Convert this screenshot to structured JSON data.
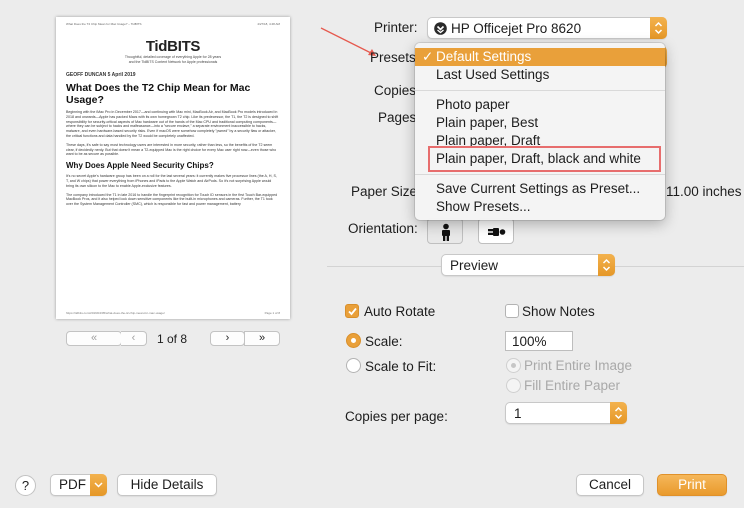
{
  "preview": {
    "header_left": "What Does the T2 Chip Mean for Mac Usage? – TidBITS",
    "header_right": "4/27/18, 4:48 AM",
    "logo": "TidBITS",
    "tagline_1": "Thoughtful, detailed coverage of everything Apple for 28 years",
    "tagline_2": "and the TidBITS Content Network for Apple professionals",
    "meta": "GEOFF DUNCAN  5 April 2019",
    "title": "What Does the T2 Chip Mean for Mac Usage?",
    "para1": "Beginning with the iMac Pro in December 2017—and continuing with Mac mini, MacBook Air, and MacBook Pro models introduced in 2018 and onwards—Apple has packed Macs with its own homegrown T2 chip. Like its predecessor, the T1, the T2 is designed to shift responsibility for security-critical aspects of Mac hardware out of the hands of the Mac CPU and traditional computing components—where they can be subject to hacks and malfeasance—into a \"secure enclave,\" a separate environment inaccessible to hacks, malware, and even hardware-based security risks. Even if macOS were somehow completely \"pwned\" by a security flaw or attacker, the critical functions and data handled by the T2 would be completely unaffected.",
    "para2": "These days, it's safe to say most technology users are interested in more security, rather than less, so the benefits of the T2 seem clear, if decidedly nerdy. But that doesn't mean a T2-equipped Mac is the right choice for every Mac user right now—even those who want to be as secure as possible.",
    "heading2": "Why Does Apple Need Security Chips?",
    "para3": "It's no secret Apple's hardware group has been on a roll for the last several years: it currently makes five processor lines (the A, H, S, T, and W chips) that power everything from iPhones and iPads to the Apple Watch and AirPods. So it's not surprising Apple would bring its own silicon to the Mac to enable Apple-exclusive features.",
    "para4": "The company introduced the T1 in late 2016 to handle the fingerprint recognition for Touch ID sensors in the first Touch Bar-equipped MacBook Pros, and it also helped lock down sensitive components like the built-in microphones and cameras. Further, the T1 took over the System Management Controller (SMC), which is responsible for fast and power management, battery",
    "footer_left": "https://tidbits.com/2019/04/05/what-does-the-t2-chip-mean-for-mac-usage/",
    "footer_right": "Page 1 of 8"
  },
  "pager": {
    "first": "«",
    "prev": "‹",
    "page_status": "1 of 8",
    "next": "›",
    "last": "»"
  },
  "printer": {
    "label": "Printer:",
    "value": "HP Officejet Pro 8620"
  },
  "presets": {
    "label": "Presets",
    "menu": {
      "selected": "Default Settings",
      "items": [
        "Default Settings",
        "Last Used Settings",
        "Photo paper",
        "Plain paper, Best",
        "Plain paper, Draft",
        "Plain paper, Draft, black and white",
        "Save Current Settings as Preset...",
        "Show Presets..."
      ]
    }
  },
  "copies": {
    "label": "Copies"
  },
  "pages": {
    "label": "Pages"
  },
  "paper_size": {
    "label": "Paper Size",
    "value_suffix": "11.00 inches"
  },
  "orientation": {
    "label": "Orientation:"
  },
  "section_popup": {
    "value": "Preview"
  },
  "options": {
    "auto_rotate": "Auto Rotate",
    "show_notes": "Show Notes",
    "scale": "Scale:",
    "scale_value": "100%",
    "scale_to_fit": "Scale to Fit:",
    "print_entire_image": "Print Entire Image",
    "fill_entire_paper": "Fill Entire Paper",
    "copies_per_page": "Copies per page:",
    "copies_per_page_value": "1"
  },
  "footer": {
    "help": "?",
    "pdf": "PDF",
    "hide_details": "Hide Details",
    "cancel": "Cancel",
    "print": "Print"
  },
  "colors": {
    "accent": "#e9a03a",
    "annotation_red": "#e76d6d"
  }
}
